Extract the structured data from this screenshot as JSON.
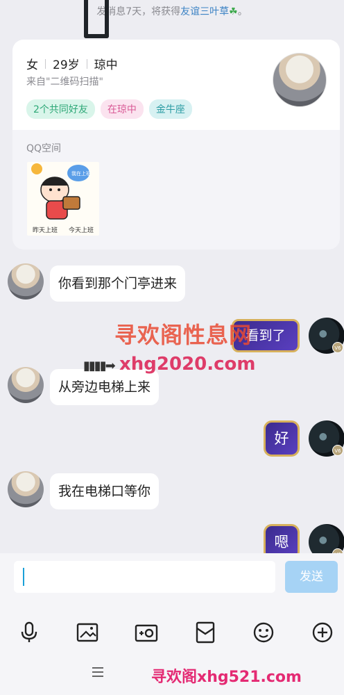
{
  "top_tip": {
    "prefix": "发消息7天，将获得",
    "highlight": "友谊三叶草",
    "suffix": "。"
  },
  "profile": {
    "gender": "女",
    "age": "29岁",
    "location": "琼中",
    "source": "来自\"二维码扫描\"",
    "tags": [
      "2个共同好友",
      "在琼中",
      "金牛座"
    ],
    "qq_space_label": "QQ空间",
    "qq_space_thumb": {
      "bubble": "我在上班",
      "caption_left": "昨天上班",
      "caption_right": "今天上班"
    }
  },
  "messages": [
    {
      "side": "left",
      "type": "text",
      "text": "你看到那个门亭进来"
    },
    {
      "side": "right",
      "type": "sticker",
      "text": "看到了",
      "level": "V6"
    },
    {
      "side": "left",
      "type": "text",
      "text": "从旁边电梯上来"
    },
    {
      "side": "right",
      "type": "sticker",
      "text": "好",
      "level": "V6"
    },
    {
      "side": "left",
      "type": "text",
      "text": "我在电梯口等你"
    },
    {
      "side": "right",
      "type": "sticker",
      "text": "嗯",
      "level": "V6"
    }
  ],
  "watermarks": {
    "line1": "寻欢阁性息网",
    "line2": "xhg2020.com",
    "bottom": "寻欢阁xhg521.com"
  },
  "input": {
    "value": "",
    "send_label": "发送"
  },
  "toolbar": [
    "microphone-icon",
    "image-icon",
    "camera-icon",
    "red-packet-icon",
    "emoji-icon",
    "plus-icon"
  ],
  "colors": {
    "accent": "#1aa0d8",
    "send_disabled": "#a6d3f5",
    "background": "#ededf2"
  }
}
